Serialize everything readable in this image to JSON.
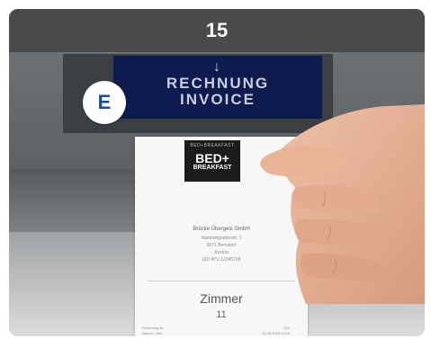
{
  "header": {
    "step_number": "15"
  },
  "badge": {
    "letter": "E"
  },
  "slot_display": {
    "arrow": "↓",
    "line1": "RECHNUNG",
    "line2": "INVOICE"
  },
  "receipt": {
    "logo_top": "BED+BREAKFAST",
    "logo_main": "BED+",
    "logo_sub": "BREAKFAST",
    "company": "Brücke Übergeis GmbH",
    "address_lines": [
      "Hammelgrabenstr. 1",
      "3671 Bernstorf",
      "Austria",
      "UID ATU 12345738"
    ],
    "label": "Zimmer",
    "room_number": "11",
    "footer_left_1": "Rechnung Nr.",
    "footer_right_1": "123",
    "footer_left_2": "Datum / Zeit",
    "footer_right_2": "11.08.2018 13:10"
  }
}
